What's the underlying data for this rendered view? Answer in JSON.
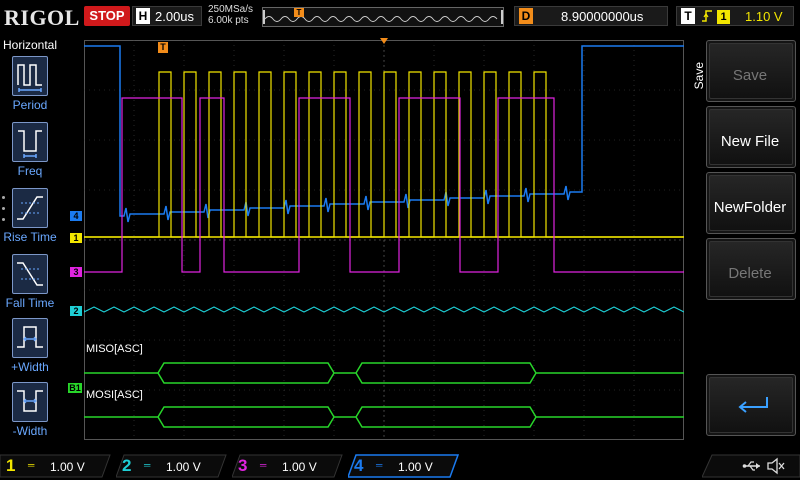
{
  "topbar": {
    "brand": "RIGOL",
    "run_state": "STOP",
    "timebase_key": "H",
    "timebase": "2.00us",
    "sample_rate": "250MSa/s",
    "memory_points": "6.00k pts",
    "delay_key": "D",
    "delay": "8.90000000us",
    "trigger_key": "T",
    "trigger_source": "1",
    "trigger_level": "1.10 V",
    "trigger_marker": "T"
  },
  "left_menu": {
    "title": "Horizontal",
    "items": [
      {
        "label": "Period",
        "icon": "period-icon"
      },
      {
        "label": "Freq",
        "icon": "freq-icon"
      },
      {
        "label": "Rise Time",
        "icon": "rise-time-icon"
      },
      {
        "label": "Fall Time",
        "icon": "fall-time-icon"
      },
      {
        "label": "+Width",
        "icon": "pos-width-icon"
      },
      {
        "label": "-Width",
        "icon": "neg-width-icon"
      }
    ]
  },
  "grid": {
    "trigger_marker": "T",
    "markers": {
      "ch4": "4",
      "ch1": "1",
      "ch3": "3",
      "ch2": "2",
      "bus": "B1"
    },
    "bus_labels": {
      "miso": "MISO[ASC]",
      "mosi": "MOSI[ASC]"
    },
    "trigger_level_marker": "T"
  },
  "right_menu": {
    "tab_label": "Save",
    "buttons": [
      {
        "label": "Save",
        "enabled": false
      },
      {
        "label": "New File",
        "enabled": true
      },
      {
        "label": "NewFolder",
        "enabled": true
      },
      {
        "label": "Delete",
        "enabled": false
      }
    ],
    "enter_icon": "enter-icon"
  },
  "channels": [
    {
      "num": "1",
      "volts": "1.00 V",
      "color": "#f2e600"
    },
    {
      "num": "2",
      "volts": "1.00 V",
      "color": "#1fcfd6"
    },
    {
      "num": "3",
      "volts": "1.00 V",
      "color": "#e024e0"
    },
    {
      "num": "4",
      "volts": "1.00 V",
      "color": "#1b7bf0"
    }
  ],
  "colors": {
    "ch1": "#f2e600",
    "ch2": "#1fcfd6",
    "ch3": "#e024e0",
    "ch4": "#1b7bf0",
    "bus": "#28d62a",
    "trigger": "#f28c1a",
    "stop": "#d0191b"
  },
  "status_icons": [
    "usb-icon",
    "speaker-muted-icon"
  ]
}
